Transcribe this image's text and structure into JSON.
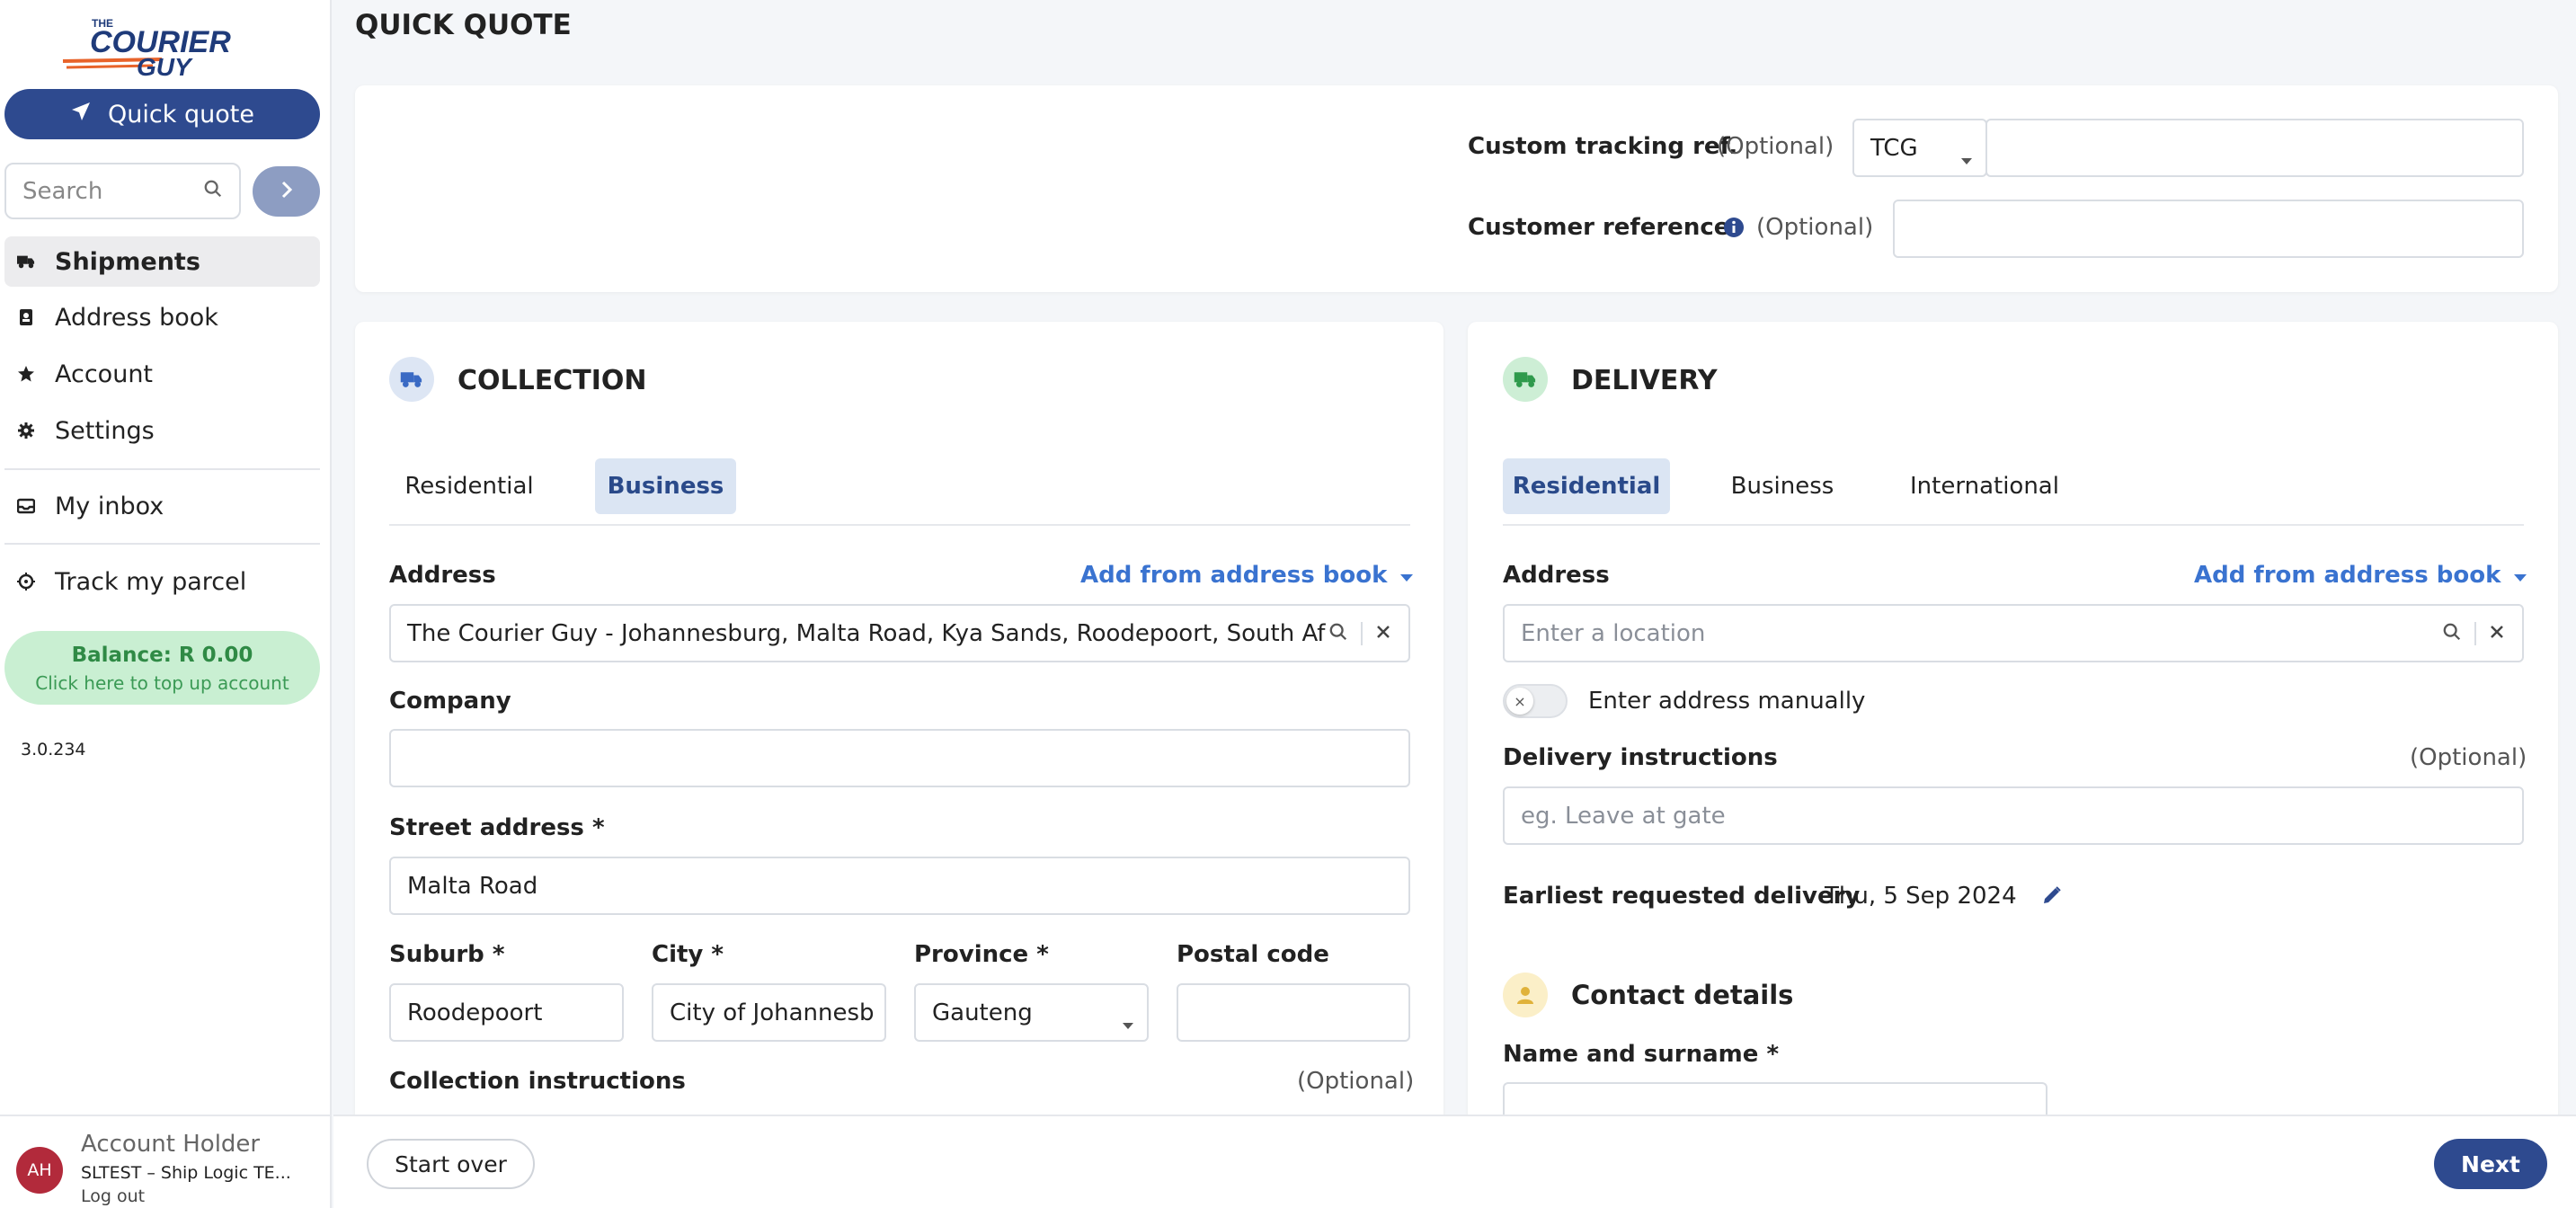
{
  "brand": {
    "logo_the": "THE",
    "logo_courier": "COURIER",
    "logo_guy": "GUY"
  },
  "sidebar": {
    "quick_quote_label": "Quick quote",
    "search_placeholder": "Search",
    "items": [
      {
        "label": "Shipments",
        "icon": "truck-icon"
      },
      {
        "label": "Address book",
        "icon": "address-book-icon"
      },
      {
        "label": "Account",
        "icon": "star-icon"
      },
      {
        "label": "Settings",
        "icon": "gear-icon"
      },
      {
        "label": "My inbox",
        "icon": "inbox-icon"
      },
      {
        "label": "Track my parcel",
        "icon": "target-icon"
      }
    ],
    "balance_label": "Balance: R 0.00",
    "balance_sub": "Click here to top up account",
    "version": "3.0.234",
    "user": {
      "initials": "AH",
      "name": "Account Holder",
      "org": "SLTEST – Ship Logic TE...",
      "logout": "Log out"
    }
  },
  "page_title": "QUICK QUOTE",
  "tracking": {
    "custom_ref_label": "Custom tracking ref.",
    "optional": "(Optional)",
    "prefix_value": "TCG",
    "customer_ref_label": "Customer reference"
  },
  "collection": {
    "title": "COLLECTION",
    "tabs": [
      "Residential",
      "Business"
    ],
    "active_tab": "Business",
    "address_label": "Address",
    "add_from_book": "Add from address book",
    "address_value": "The Courier Guy - Johannesburg, Malta Road, Kya Sands, Roodepoort, South Af",
    "company_label": "Company",
    "street_label": "Street address *",
    "street_value": "Malta Road",
    "suburb_label": "Suburb *",
    "suburb_value": "Roodepoort",
    "city_label": "City *",
    "city_value": "City of Johannesb",
    "province_label": "Province *",
    "province_value": "Gauteng",
    "postal_label": "Postal code",
    "instructions_label": "Collection instructions",
    "optional": "(Optional)"
  },
  "delivery": {
    "title": "DELIVERY",
    "tabs": [
      "Residential",
      "Business",
      "International"
    ],
    "active_tab": "Residential",
    "address_label": "Address",
    "add_from_book": "Add from address book",
    "address_placeholder": "Enter a location",
    "manual_label": "Enter address manually",
    "instructions_label": "Delivery instructions",
    "optional": "(Optional)",
    "instructions_placeholder": "eg. Leave at gate",
    "earliest_label": "Earliest requested delivery",
    "earliest_value": "Thu, 5 Sep 2024",
    "contact_title": "Contact details",
    "name_label": "Name and surname *"
  },
  "footer": {
    "start_over": "Start over",
    "next": "Next"
  },
  "colors": {
    "primary": "#2e4a8f",
    "link": "#3a73d0",
    "success": "#c9efd2"
  }
}
